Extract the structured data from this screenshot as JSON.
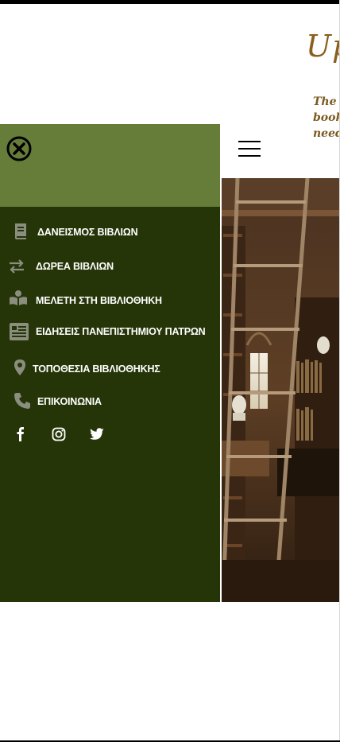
{
  "header": {
    "title": "Up",
    "subtitle": "The book need"
  },
  "drawer": {
    "items": [
      {
        "label": "ΔΑΝΕΙΣΜΟΣ ΒΙΒΛΙΩΝ",
        "icon": "book-icon"
      },
      {
        "label": "ΔΩΡΕΑ ΒΙΒΛΙΩΝ",
        "icon": "exchange-icon"
      },
      {
        "label": "ΜΕΛΕΤΗ ΣΤΗ ΒΙΒΛΙΟΘΗΚΗ",
        "icon": "reader-icon"
      },
      {
        "label": "ΕΙΔΗΣΕΙΣ ΠΑΝΕΠΙΣΤΗΜΙΟΥ ΠΑΤΡΩΝ",
        "icon": "newspaper-icon"
      },
      {
        "label": "ΤΟΠΟΘΕΣΙΑ ΒΙΒΛΙΟΘΗΚΗΣ",
        "icon": "map-pin-icon"
      },
      {
        "label": "ΕΠΙΚΟΙΝΩΝΙΑ",
        "icon": "phone-icon"
      }
    ],
    "social": [
      "facebook-icon",
      "instagram-icon",
      "twitter-icon"
    ]
  },
  "colors": {
    "drawer_bg": "#263508",
    "drawer_header_bg": "#667d3a",
    "title_color": "#8a5e1c"
  }
}
